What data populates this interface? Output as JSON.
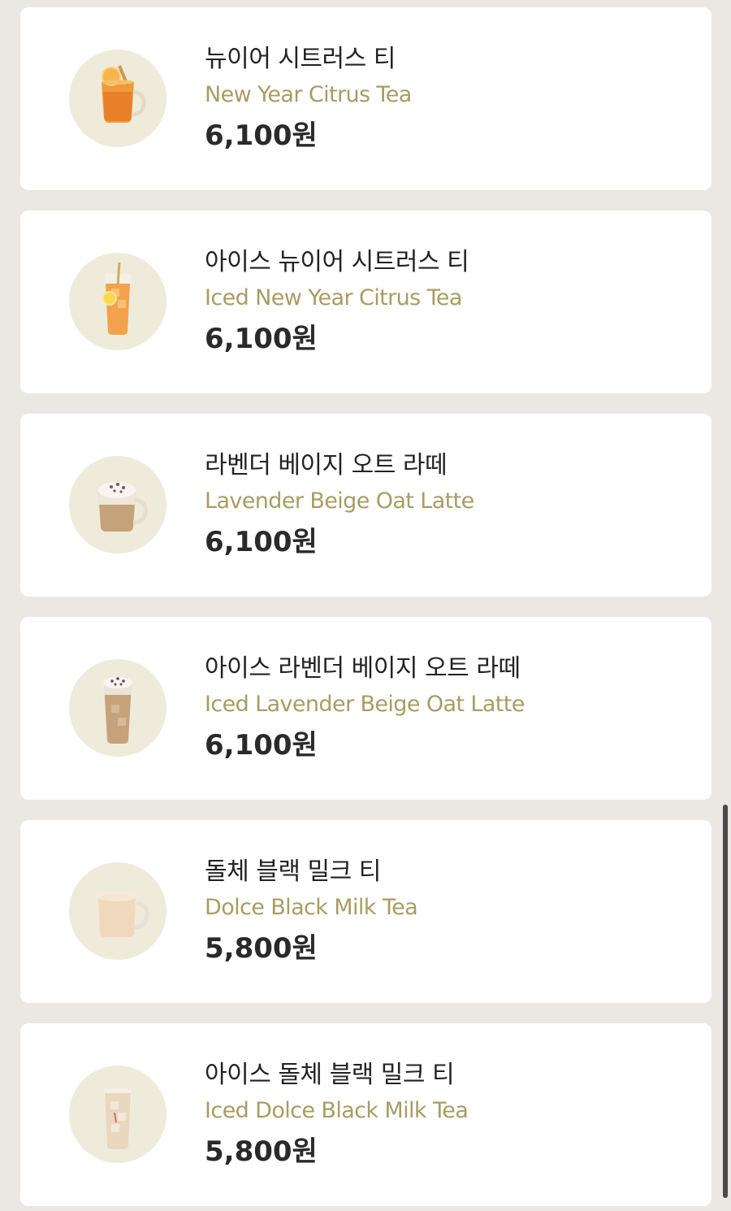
{
  "menu": {
    "items": [
      {
        "name_ko": "뉴이어 시트러스 티",
        "name_en": "New Year Citrus Tea",
        "price": "6,100원",
        "image_icon": "hot-citrus-tea-mug-icon"
      },
      {
        "name_ko": "아이스 뉴이어 시트러스 티",
        "name_en": "Iced New Year Citrus Tea",
        "price": "6,100원",
        "image_icon": "iced-citrus-tea-glass-icon"
      },
      {
        "name_ko": "라벤더 베이지 오트 라떼",
        "name_en": "Lavender Beige Oat Latte",
        "price": "6,100원",
        "image_icon": "hot-lavender-latte-mug-icon"
      },
      {
        "name_ko": "아이스 라벤더 베이지 오트 라떼",
        "name_en": "Iced Lavender Beige Oat Latte",
        "price": "6,100원",
        "image_icon": "iced-lavender-latte-glass-icon"
      },
      {
        "name_ko": "돌체 블랙 밀크 티",
        "name_en": "Dolce Black Milk Tea",
        "price": "5,800원",
        "image_icon": "hot-milk-tea-mug-icon"
      },
      {
        "name_ko": "아이스 돌체 블랙 밀크 티",
        "name_en": "Iced Dolce Black Milk Tea",
        "price": "5,800원",
        "image_icon": "iced-milk-tea-glass-icon"
      }
    ]
  },
  "colors": {
    "background": "#ebe7e3",
    "card": "#ffffff",
    "thumb_bg": "#efebdb",
    "english_name": "#a79d63",
    "text": "#222222"
  }
}
